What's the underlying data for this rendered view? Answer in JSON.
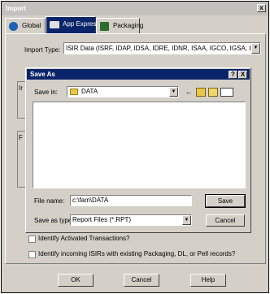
{
  "window": {
    "title": "Import",
    "close_glyph": "x"
  },
  "tabs": [
    {
      "label": "Global",
      "icon": "globe-icon"
    },
    {
      "label": "App Express",
      "icon": "app-express-icon"
    },
    {
      "label": "Packaging",
      "icon": "packaging-icon"
    }
  ],
  "import_type": {
    "label": "Import Type:",
    "value": "ISIR Data (ISRF, IDAP, IDSA, IDRE, IDNR, ISAA, IGCO, IGSA, IGSG, I"
  },
  "partial_labels": [
    "Ir",
    "F"
  ],
  "options": {
    "identify_activated": "Identify Activated Transactions?",
    "identify_incoming": "Identify incoming ISIRs with existing Packaging, DL, or Pell records?"
  },
  "buttons": {
    "ok": "OK",
    "cancel": "Cancel",
    "help": "Help"
  },
  "save_as": {
    "title": "Save As",
    "help_glyph": "?",
    "close_glyph": "X",
    "save_in_label": "Save in:",
    "save_in_value": "DATA",
    "file_name_label": "File name:",
    "file_name_value": "c:\\fam\\DATA",
    "save_as_type_label": "Save as type:",
    "save_as_type_value": "Report Files (*.RPT)",
    "save_button": "Save",
    "cancel_button": "Cancel"
  },
  "colors": {
    "dialog_title_bg": "#0a246a",
    "window_title_bg": "#c3c1bd",
    "face": "#d4d0c8"
  }
}
